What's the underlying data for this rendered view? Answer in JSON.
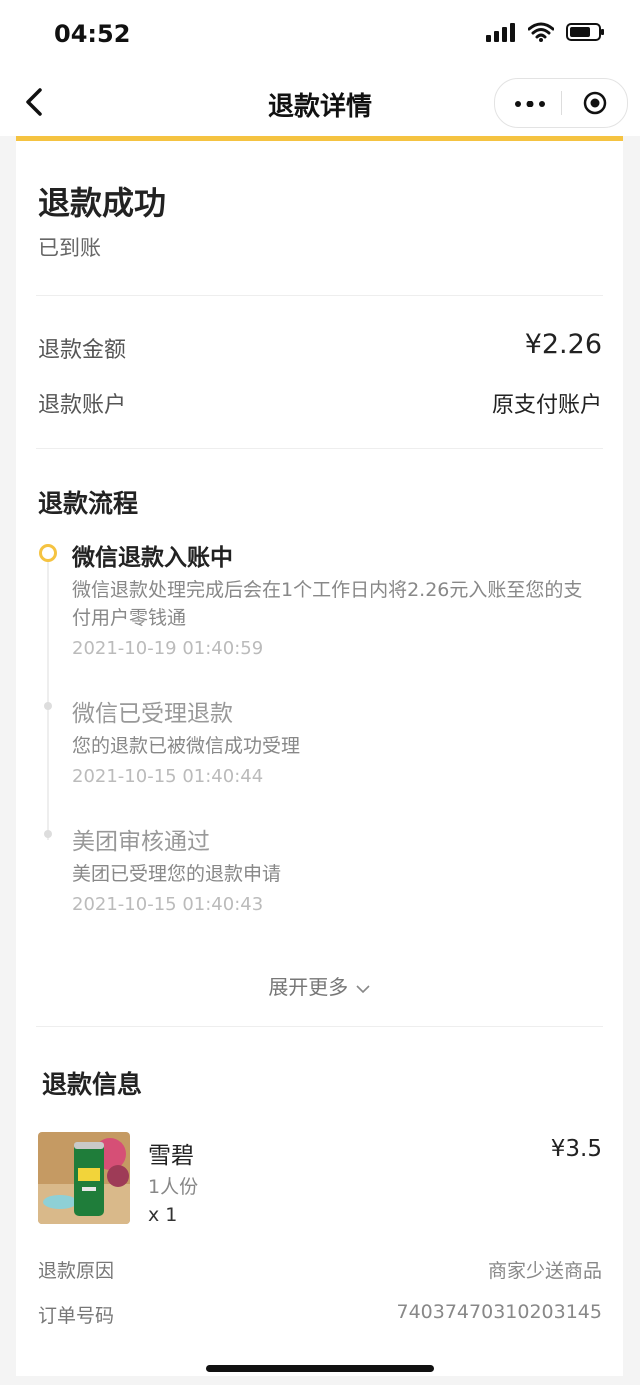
{
  "status_bar": {
    "time": "04:52"
  },
  "nav": {
    "title": "退款详情"
  },
  "refund_status": {
    "title": "退款成功",
    "subtitle": "已到账"
  },
  "refund_amount": {
    "label": "退款金额",
    "value": "¥2.26"
  },
  "refund_account": {
    "label": "退款账户",
    "value": "原支付账户"
  },
  "process": {
    "title": "退款流程",
    "steps": [
      {
        "title": "微信退款入账中",
        "desc": "微信退款处理完成后会在1个工作日内将2.26元入账至您的支付用户零钱通",
        "time": "2021-10-19 01:40:59"
      },
      {
        "title": "微信已受理退款",
        "desc": "您的退款已被微信成功受理",
        "time": "2021-10-15 01:40:44"
      },
      {
        "title": "美团审核通过",
        "desc": "美团已受理您的退款申请",
        "time": "2021-10-15 01:40:43"
      }
    ],
    "expand_label": "展开更多"
  },
  "refund_info": {
    "title": "退款信息",
    "product": {
      "name": "雪碧",
      "spec": "1人份",
      "qty": "x 1",
      "price": "¥3.5"
    },
    "reason": {
      "label": "退款原因",
      "value": "商家少送商品"
    },
    "order_no": {
      "label": "订单号码",
      "value": "74037470310203145"
    }
  },
  "colors": {
    "accent": "#f5c341"
  }
}
